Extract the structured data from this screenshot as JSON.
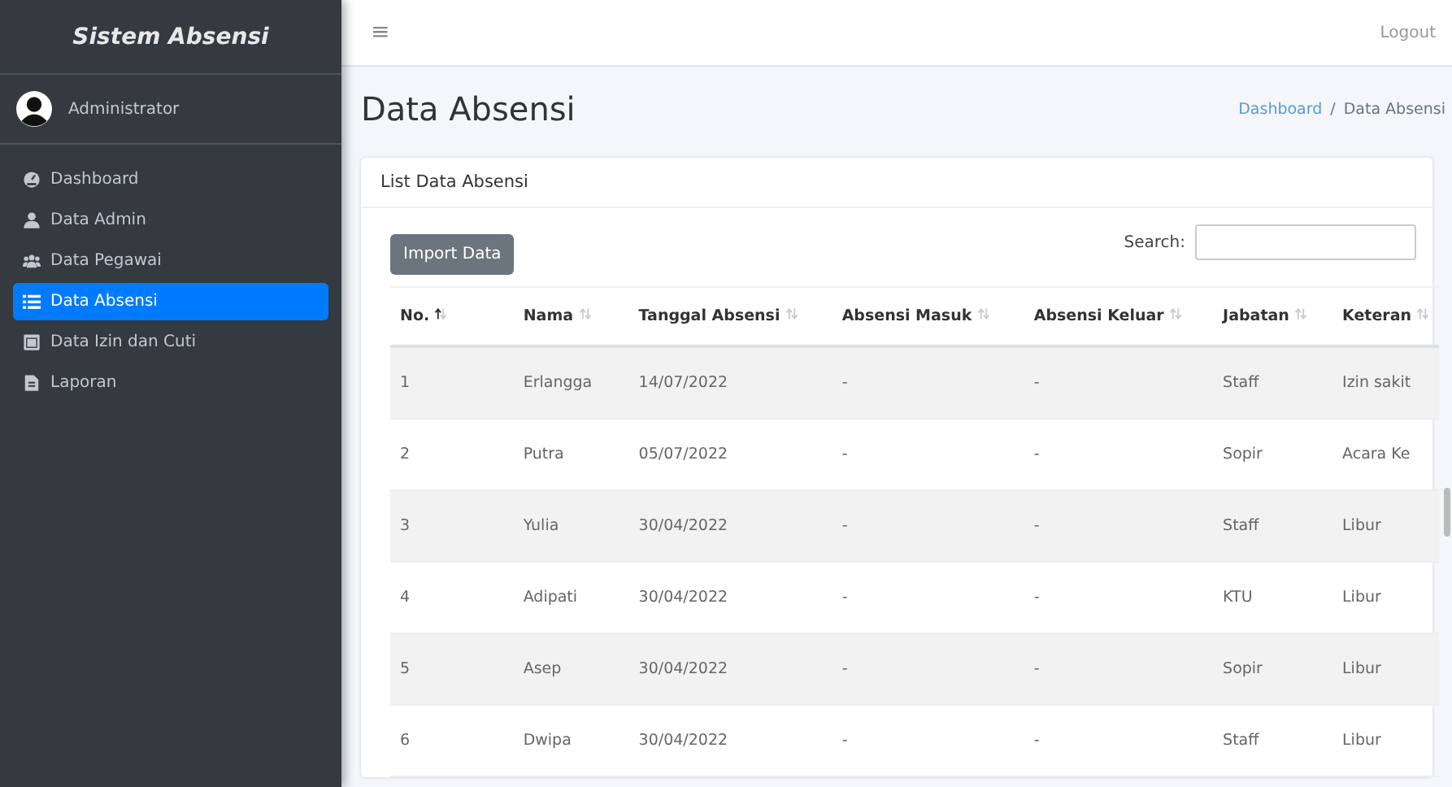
{
  "sidebar": {
    "brand": "Sistem Absensi",
    "user": "Administrator",
    "items": [
      {
        "label": "Dashboard",
        "selected": false
      },
      {
        "label": "Data Admin",
        "selected": false
      },
      {
        "label": "Data Pegawai",
        "selected": false
      },
      {
        "label": "Data Absensi",
        "selected": true
      },
      {
        "label": "Data Izin dan Cuti",
        "selected": false
      },
      {
        "label": "Laporan",
        "selected": false
      }
    ]
  },
  "navbar": {
    "menu": "≡",
    "logout": "Logout"
  },
  "page": {
    "title": "Data Absensi",
    "breadcrumb": [
      {
        "label": "Dashboard",
        "link": true
      },
      {
        "label": "Data Absensi",
        "link": false
      }
    ],
    "breadcrumb_separator": "/"
  },
  "card": {
    "title": "List Data Absensi",
    "import_button": "Import Data",
    "search_label": "Search:",
    "table": {
      "columns": [
        {
          "label": "No.",
          "selected": true
        },
        {
          "label": "Nama",
          "selected": false
        },
        {
          "label": "Tanggal Absensi",
          "selected": false
        },
        {
          "label": "Absensi Masuk",
          "selected": false
        },
        {
          "label": "Absensi Keluar",
          "selected": false
        },
        {
          "label": "Jabatan",
          "selected": false
        },
        {
          "label": "Keteran",
          "selected": false
        }
      ],
      "rows": [
        [
          "1",
          "Erlangga",
          "14/07/2022",
          "-",
          "-",
          "Staff",
          "Izin sakit"
        ],
        [
          "2",
          "Putra",
          "05/07/2022",
          "-",
          "-",
          "Sopir",
          "Acara Ke"
        ],
        [
          "3",
          "Yulia",
          "30/04/2022",
          "-",
          "-",
          "Staff",
          "Libur"
        ],
        [
          "4",
          "Adipati",
          "30/04/2022",
          "-",
          "-",
          "KTU",
          "Libur"
        ],
        [
          "5",
          "Asep",
          "30/04/2022",
          "-",
          "-",
          "Sopir",
          "Libur"
        ],
        [
          "6",
          "Dwipa",
          "30/04/2022",
          "-",
          "-",
          "Staff",
          "Libur"
        ]
      ]
    }
  }
}
